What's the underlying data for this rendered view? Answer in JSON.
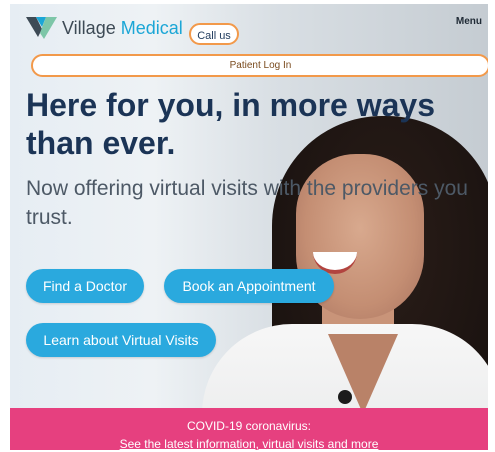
{
  "header": {
    "logo": {
      "word1": "Village",
      "word2": "Medical",
      "icon": "village-medical-v-logo"
    },
    "call_label": "Call us",
    "menu_label": "Menu"
  },
  "login": {
    "label": "Patient Log In"
  },
  "hero": {
    "headline": "Here for you, in more ways than ever.",
    "subheadline": "Now offering virtual visits with the providers you trust."
  },
  "buttons": {
    "find_doctor": "Find a Doctor",
    "book_appointment": "Book an Appointment",
    "virtual_visits": "Learn about Virtual Visits"
  },
  "banner": {
    "title": "COVID-19 coronavirus:",
    "link": "See the latest information, virtual visits and more"
  },
  "colors": {
    "accent_blue": "#2aa9de",
    "outline_orange": "#f2994a",
    "headline_navy": "#1b3456",
    "banner_pink": "#e6407f"
  }
}
